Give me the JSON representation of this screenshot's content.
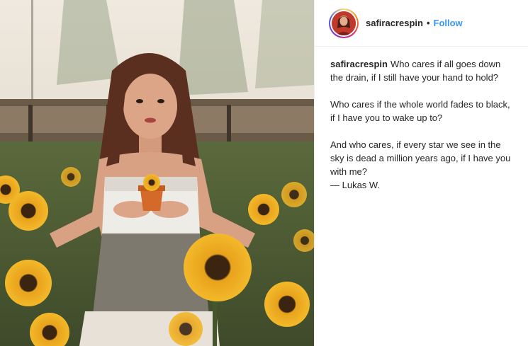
{
  "post": {
    "photo": {
      "alt": ""
    },
    "header": {
      "avatar_icon": "profile-avatar-icon",
      "username": "safiracrespin",
      "separator": "•",
      "follow_label": "Follow"
    },
    "caption": {
      "username": "safiracrespin",
      "paragraph_1": "Who cares if all goes down the drain, if I still have your hand to hold?",
      "paragraph_2": "Who cares if the whole world fades to black, if I have you to wake up to?",
      "paragraph_3_line_1": "And who cares, if every star we see in the sky is dead a million years ago, if I have you with me?",
      "paragraph_3_line_2": "— Lukas W."
    },
    "colors": {
      "follow_link": "#3897f0",
      "text": "#262626",
      "divider": "#efefef"
    }
  }
}
